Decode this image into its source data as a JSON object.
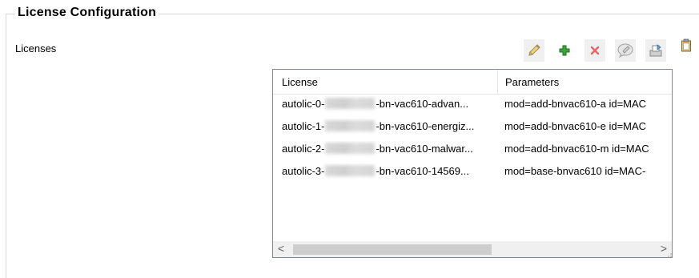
{
  "group": {
    "title": "License Configuration"
  },
  "licenses_label": "Licenses",
  "toolbar": {
    "buttons": [
      {
        "icon": "edit-pencil-icon"
      },
      {
        "icon": "add-plus-icon",
        "color": "#2e9e2e"
      },
      {
        "icon": "delete-x-icon",
        "color": "#e05050"
      },
      {
        "icon": "comment-icon"
      },
      {
        "icon": "export-icon"
      },
      {
        "icon": "clipboard-icon"
      }
    ]
  },
  "list": {
    "columns": [
      "License",
      "Parameters"
    ],
    "rows": [
      {
        "license_prefix": "autolic-0-",
        "license_suffix": "-bn-vac610-advan...",
        "parameters": "mod=add-bnvac610-a id=MAC"
      },
      {
        "license_prefix": "autolic-1-",
        "license_suffix": "-bn-vac610-energiz...",
        "parameters": "mod=add-bnvac610-e id=MAC"
      },
      {
        "license_prefix": "autolic-2-",
        "license_suffix": "-bn-vac610-malwar...",
        "parameters": "mod=add-bnvac610-m id=MAC"
      },
      {
        "license_prefix": "autolic-3-",
        "license_suffix": "-bn-vac610-14569...",
        "parameters": "mod=base-bnvac610 id=MAC-"
      }
    ]
  },
  "scrollbar": {
    "left_arrow": "<",
    "right_arrow": ">"
  }
}
